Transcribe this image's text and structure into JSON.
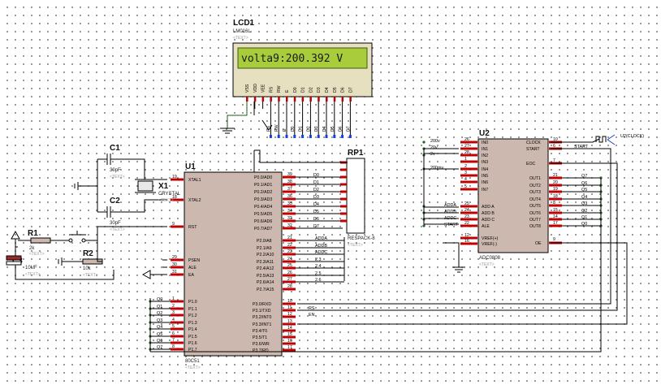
{
  "lcd": {
    "ref": "LCD1",
    "model": "LM016L",
    "text_tag": "<TEXT>",
    "display": "volta9:200.392 V",
    "pins": [
      "VSS",
      "VDD",
      "VEE",
      "RS",
      "RW",
      "E",
      "D0",
      "D1",
      "D2",
      "D3",
      "D4",
      "D5",
      "D6",
      "D7"
    ],
    "bus": [
      "RS",
      "RW",
      "E",
      "D0",
      "D1",
      "D2",
      "D3",
      "D4",
      "D5",
      "D6",
      "D7"
    ]
  },
  "u1": {
    "ref": "U1",
    "model": "80C51",
    "text_tag": "<TEXT>",
    "left_pins": [
      {
        "num": "19",
        "name": "XTAL1"
      },
      {
        "num": "18",
        "name": "XTAL2"
      },
      {
        "num": "9",
        "name": "RST"
      },
      {
        "num": "29",
        "name": "PSEN"
      },
      {
        "num": "30",
        "name": "ALE"
      },
      {
        "num": "31",
        "name": "EA"
      },
      {
        "num": "1",
        "name": "P1.0"
      },
      {
        "num": "2",
        "name": "P1.1"
      },
      {
        "num": "3",
        "name": "P1.2"
      },
      {
        "num": "4",
        "name": "P1.3"
      },
      {
        "num": "5",
        "name": "P1.4"
      },
      {
        "num": "6",
        "name": "P1.5"
      },
      {
        "num": "7",
        "name": "P1.6"
      },
      {
        "num": "8",
        "name": "P1.7"
      }
    ],
    "p0": [
      {
        "name": "P0.0/AD0",
        "num": "39"
      },
      {
        "name": "P0.1/AD1",
        "num": "38"
      },
      {
        "name": "P0.2/AD2",
        "num": "37"
      },
      {
        "name": "P0.3/AD3",
        "num": "36"
      },
      {
        "name": "P0.4/AD4",
        "num": "35"
      },
      {
        "name": "P0.5/AD5",
        "num": "34"
      },
      {
        "name": "P0.6/AD6",
        "num": "33"
      },
      {
        "name": "P0.7/AD7",
        "num": "32"
      }
    ],
    "p2": [
      {
        "name": "P2.0/A8",
        "num": "21"
      },
      {
        "name": "P2.1/A9",
        "num": "22"
      },
      {
        "name": "P2.2/A10",
        "num": "23"
      },
      {
        "name": "P2.3/A11",
        "num": "24"
      },
      {
        "name": "P2.4/A12",
        "num": "25"
      },
      {
        "name": "P2.5/A13",
        "num": "26"
      },
      {
        "name": "P2.6/A14",
        "num": "27"
      },
      {
        "name": "P2.7/A15",
        "num": "28"
      }
    ],
    "p3": [
      {
        "name": "P3.0/RXD",
        "num": "10"
      },
      {
        "name": "P3.1/TXD",
        "num": "11"
      },
      {
        "name": "P3.2/INT0",
        "num": "12"
      },
      {
        "name": "P3.3/INT1",
        "num": "13"
      },
      {
        "name": "P3.4/T0",
        "num": "14"
      },
      {
        "name": "P3.5/T1",
        "num": "15"
      },
      {
        "name": "P3.6/WR",
        "num": "16"
      },
      {
        "name": "P3.7/RD",
        "num": "17"
      }
    ],
    "p0_nets": [
      "D0",
      "D1",
      "D2",
      "D3",
      "D4",
      "D5",
      "D6",
      "D7"
    ],
    "p2_nets": [
      "ADDA",
      "ADDB",
      "ADDC",
      "2.3",
      "2.4",
      "2.5",
      "2.6",
      ""
    ],
    "p3_nets": [
      "",
      "RS",
      "EN",
      "",
      "",
      "",
      "",
      ""
    ],
    "p1_nets": [
      "Q0",
      "Q1",
      "Q2",
      "Q3",
      "Q4",
      "Q5",
      "Q6",
      "Q7"
    ]
  },
  "rp1": {
    "ref": "RP1",
    "model": "RESPACK-8",
    "text_tag": "<TEXT>"
  },
  "u2": {
    "ref": "U2",
    "model": "ADC0808",
    "text_tag": "<TEXT>",
    "in_pins": [
      {
        "num": "26",
        "name": "IN0",
        "net": "200v"
      },
      {
        "num": "27",
        "name": "IN1",
        "net": "20v"
      },
      {
        "num": "28",
        "name": "IN2",
        "net": "2v"
      },
      {
        "num": "1",
        "name": "IN3",
        "net": ""
      },
      {
        "num": "2",
        "name": "IN4",
        "net": "200mv"
      },
      {
        "num": "3",
        "name": "IN5",
        "net": ""
      },
      {
        "num": "4",
        "name": "IN6",
        "net": ""
      },
      {
        "num": "5",
        "name": "IN7",
        "net": ""
      }
    ],
    "addr_pins": [
      {
        "num": "25",
        "name": "ADD A",
        "net": "ADDA"
      },
      {
        "num": "24",
        "name": "ADD B",
        "net": "ADDB"
      },
      {
        "num": "23",
        "name": "ADD C",
        "net": "ADDC"
      },
      {
        "num": "22",
        "name": "ALE",
        "net": "START"
      }
    ],
    "vref_pins": [
      {
        "num": "12",
        "name": "VREF(+)"
      },
      {
        "num": "16",
        "name": "VREF(-)"
      }
    ],
    "right_top": [
      {
        "num": "10",
        "name": "CLOCK"
      },
      {
        "num": "6",
        "name": "START"
      },
      {
        "num": "7",
        "name": "EOC"
      }
    ],
    "out_pins": [
      {
        "num": "21",
        "name": "OUT1",
        "net": "Q7"
      },
      {
        "num": "20",
        "name": "OUT2",
        "net": "Q6"
      },
      {
        "num": "19",
        "name": "OUT3",
        "net": "Q5"
      },
      {
        "num": "18",
        "name": "OUT4",
        "net": "Q4"
      },
      {
        "num": "8",
        "name": "OUT5",
        "net": "Q3"
      },
      {
        "num": "15",
        "name": "OUT6",
        "net": "Q2"
      },
      {
        "num": "14",
        "name": "OUT7",
        "net": "Q1"
      },
      {
        "num": "17",
        "name": "OUT8",
        "net": "Q0"
      }
    ],
    "oe": {
      "num": "9",
      "name": "OE"
    },
    "start_net": "START",
    "clock_label": "U2(CLOCK)"
  },
  "c1": {
    "ref": "C1",
    "value": "30pF",
    "text_tag": "<TEXT>"
  },
  "c2": {
    "ref": "C2",
    "value": "30pF",
    "text_tag": "<TEXT>"
  },
  "c3": {
    "ref": "C3",
    "value": "10UF",
    "text_tag": "<TEXT>"
  },
  "x1": {
    "ref": "X1",
    "value": "CRYSTAL",
    "text_tag": "<TEXT>"
  },
  "r1": {
    "ref": "R1",
    "value": "2k",
    "text_tag": "<TEXT>"
  },
  "r2": {
    "ref": "R2",
    "value": "10k",
    "text_tag": "<TEXT>"
  },
  "colors": {
    "pin_red": "#c00000",
    "pin_blue": "#1a3fd6",
    "pin_green": "#1f5f1f",
    "chip_fill": "#cdb8b0",
    "lcd_screen": "#a8cc3c",
    "lcd_frame": "#e6e0c0"
  }
}
